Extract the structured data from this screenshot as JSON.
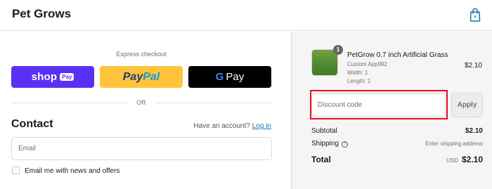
{
  "header": {
    "brand": "Pet Grows",
    "cart_icon": "shopping-bag-icon"
  },
  "express": {
    "title": "Express checkout",
    "shop_pay": {
      "word": "shop",
      "tag": "Pay"
    },
    "paypal": {
      "part_a": "Pay",
      "part_b": "Pal"
    },
    "google_pay": {
      "g": "G",
      "word": "Pay"
    },
    "or": "OR"
  },
  "contact": {
    "title": "Contact",
    "have_account": "Have an account?",
    "login": "Log in",
    "email_placeholder": "Email",
    "optin_label": "Email me with news and offers"
  },
  "summary": {
    "product": {
      "name": "PetGrow 0.7 inch Artificial Grass",
      "quantity": "1",
      "options": [
        "Custom App992",
        "Width: 1",
        "Length: 1"
      ],
      "price": "$2.10"
    },
    "discount_placeholder": "Discount code",
    "apply_label": "Apply",
    "subtotal_label": "Subtotal",
    "subtotal_value": "$2.10",
    "shipping_label": "Shipping",
    "shipping_value": "Enter shipping address",
    "total_label": "Total",
    "total_currency": "USD",
    "total_value": "$2.10"
  },
  "colors": {
    "shop_pay": "#5a31f4",
    "paypal": "#ffc439",
    "google_pay": "#000000",
    "link": "#1773b0",
    "highlight": "#e8101a"
  }
}
